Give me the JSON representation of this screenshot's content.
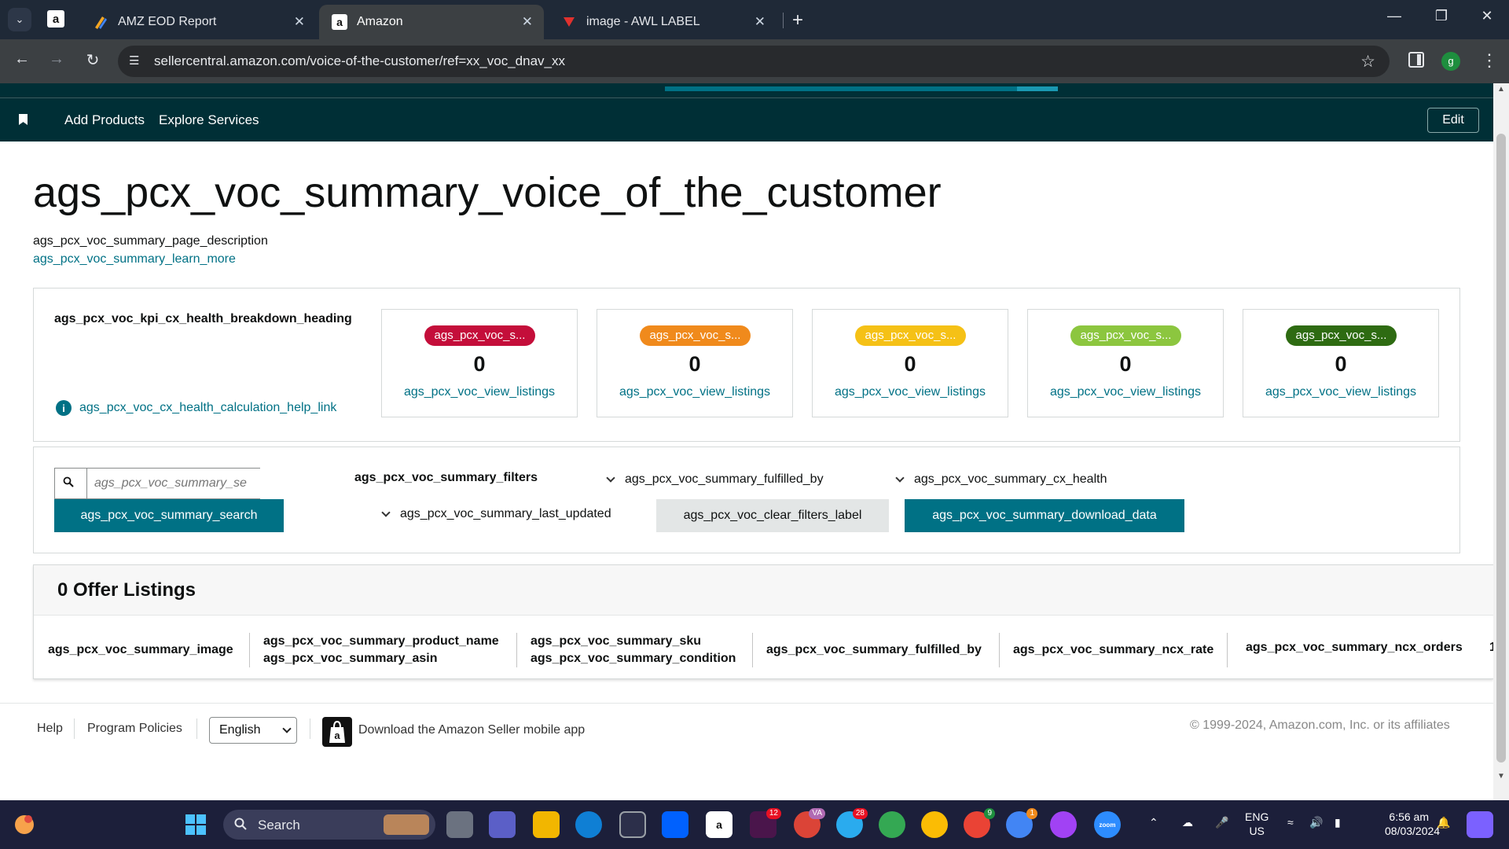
{
  "browser": {
    "tabs": [
      {
        "title": "AMZ EOD Report"
      },
      {
        "title": "Amazon"
      },
      {
        "title": "image - AWL LABEL"
      }
    ],
    "url": "sellercentral.amazon.com/voice-of-the-customer/ref=xx_voc_dnav_xx",
    "profile_initial": "g"
  },
  "nav": {
    "add_products": "Add Products",
    "explore_services": "Explore Services",
    "edit": "Edit"
  },
  "page": {
    "title": "ags_pcx_voc_summary_voice_of_the_customer",
    "description": "ags_pcx_voc_summary_page_description",
    "learn_more": "ags_pcx_voc_summary_learn_more"
  },
  "kpi": {
    "heading": "ags_pcx_voc_kpi_cx_health_breakdown_heading",
    "help_link": "ags_pcx_voc_cx_health_calculation_help_link",
    "cards": [
      {
        "pill": "ags_pcx_voc_s...",
        "count": "0",
        "link": "ags_pcx_voc_view_listings",
        "color": "#c40e3a"
      },
      {
        "pill": "ags_pcx_voc_s...",
        "count": "0",
        "link": "ags_pcx_voc_view_listings",
        "color": "#f08a1c"
      },
      {
        "pill": "ags_pcx_voc_s...",
        "count": "0",
        "link": "ags_pcx_voc_view_listings",
        "color": "#f5c116"
      },
      {
        "pill": "ags_pcx_voc_s...",
        "count": "0",
        "link": "ags_pcx_voc_view_listings",
        "color": "#8cc63f"
      },
      {
        "pill": "ags_pcx_voc_s...",
        "count": "0",
        "link": "ags_pcx_voc_view_listings",
        "color": "#2e6b12"
      }
    ]
  },
  "filters": {
    "search_placeholder": "ags_pcx_voc_summary_se",
    "search_button": "ags_pcx_voc_summary_search",
    "label": "ags_pcx_voc_summary_filters",
    "fulfilled_by": "ags_pcx_voc_summary_fulfilled_by",
    "cx_health": "ags_pcx_voc_summary_cx_health",
    "last_updated": "ags_pcx_voc_summary_last_updated",
    "clear": "ags_pcx_voc_clear_filters_label",
    "download": "ags_pcx_voc_summary_download_data"
  },
  "listings": {
    "title": "0 Offer Listings",
    "columns": [
      {
        "line1": "ags_pcx_voc_summary_image",
        "line2": ""
      },
      {
        "line1": "ags_pcx_voc_summary_product_name",
        "line2": "ags_pcx_voc_summary_asin"
      },
      {
        "line1": "ags_pcx_voc_summary_sku",
        "line2": "ags_pcx_voc_summary_condition"
      },
      {
        "line1": "ags_pcx_voc_summary_fulfilled_by",
        "line2": ""
      },
      {
        "line1": "ags_pcx_voc_summary_ncx_rate",
        "line2": ""
      },
      {
        "line1": "ags_pcx_voc_summary_ncx_orders",
        "line2": ""
      },
      {
        "line1": "1",
        "line2": ""
      }
    ]
  },
  "footer": {
    "help": "Help",
    "policies": "Program Policies",
    "language": "English",
    "app": "Download the Amazon Seller mobile app",
    "copyright": "© 1999-2024, Amazon.com, Inc. or its affiliates"
  },
  "taskbar": {
    "search": "Search",
    "lang_line1": "ENG",
    "lang_line2": "US",
    "time": "6:56 am",
    "date": "08/03/2024",
    "badges": {
      "slack": "12",
      "telegram": "28",
      "chrome_w": "9",
      "chrome_o": "1",
      "chrome_v": "VA"
    }
  }
}
